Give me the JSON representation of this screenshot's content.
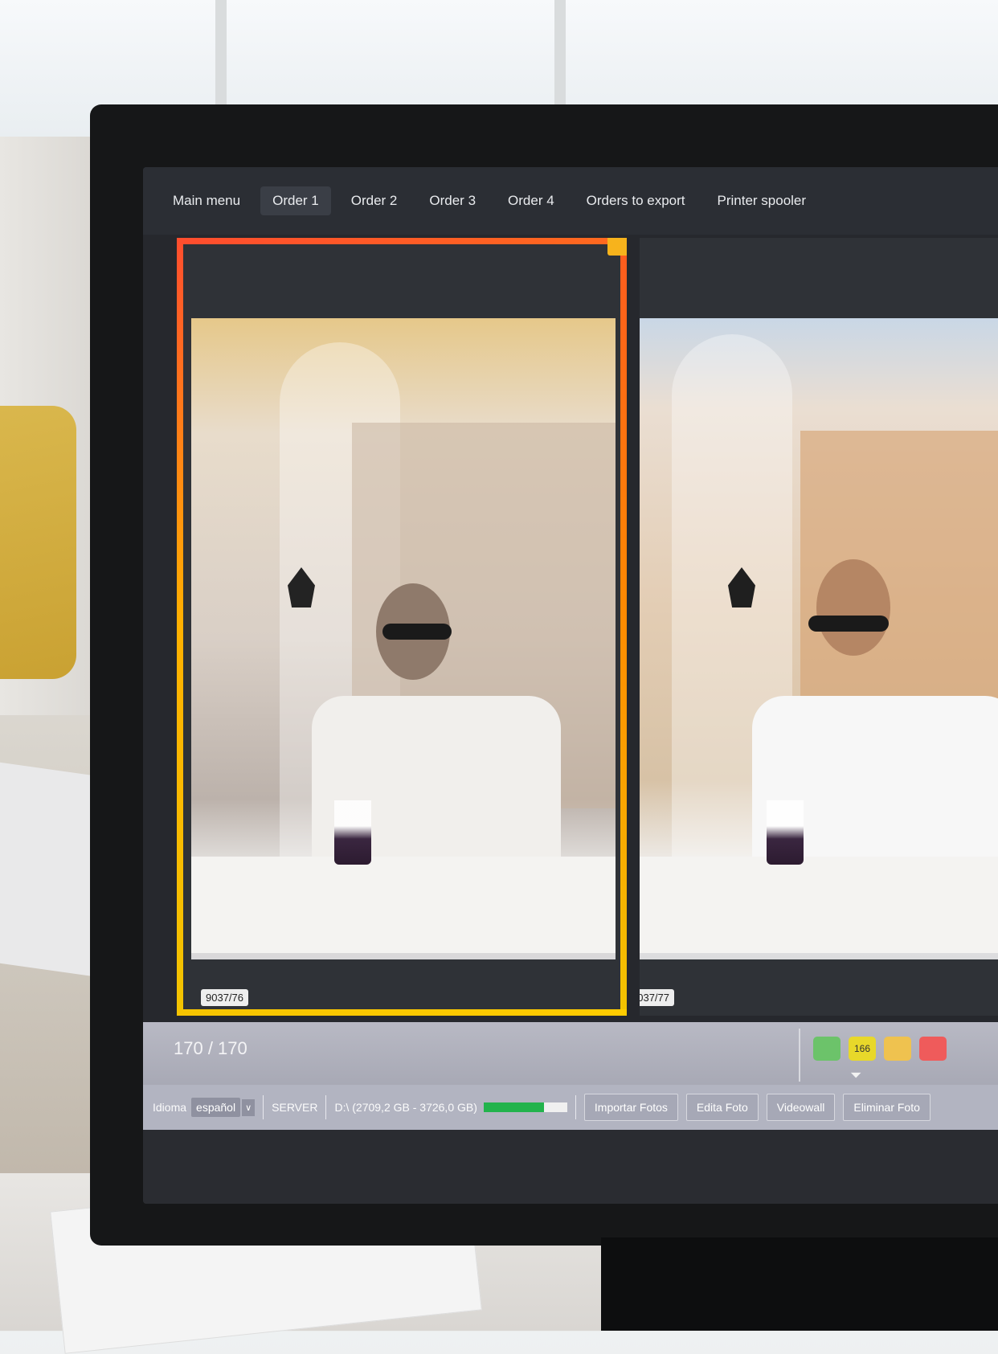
{
  "nav": {
    "tabs": [
      {
        "label": "Main menu"
      },
      {
        "label": "Order 1"
      },
      {
        "label": "Order 2"
      },
      {
        "label": "Order 3"
      },
      {
        "label": "Order 4"
      },
      {
        "label": "Orders to export"
      },
      {
        "label": "Printer spooler"
      }
    ]
  },
  "gallery": {
    "photos": [
      {
        "label": "9037/76",
        "selected": true
      },
      {
        "label": "9037/77",
        "selected": false
      }
    ]
  },
  "status": {
    "counter": "170 / 170",
    "color_filters": [
      {
        "color": "#6cc36a",
        "count": ""
      },
      {
        "color": "#e8d82a",
        "count": "166"
      },
      {
        "color": "#efc24f",
        "count": ""
      },
      {
        "color": "#ef5b5b",
        "count": ""
      }
    ]
  },
  "footer": {
    "language_label": "Idioma",
    "language_value": "español",
    "server_label": "SERVER",
    "disk_info": "D:\\ (2709,2 GB - 3726,0 GB)",
    "disk_used_fraction": 0.727,
    "buttons": [
      {
        "label": "Importar Fotos"
      },
      {
        "label": "Edita Foto"
      },
      {
        "label": "Videowall"
      },
      {
        "label": "Eliminar Foto"
      }
    ]
  }
}
